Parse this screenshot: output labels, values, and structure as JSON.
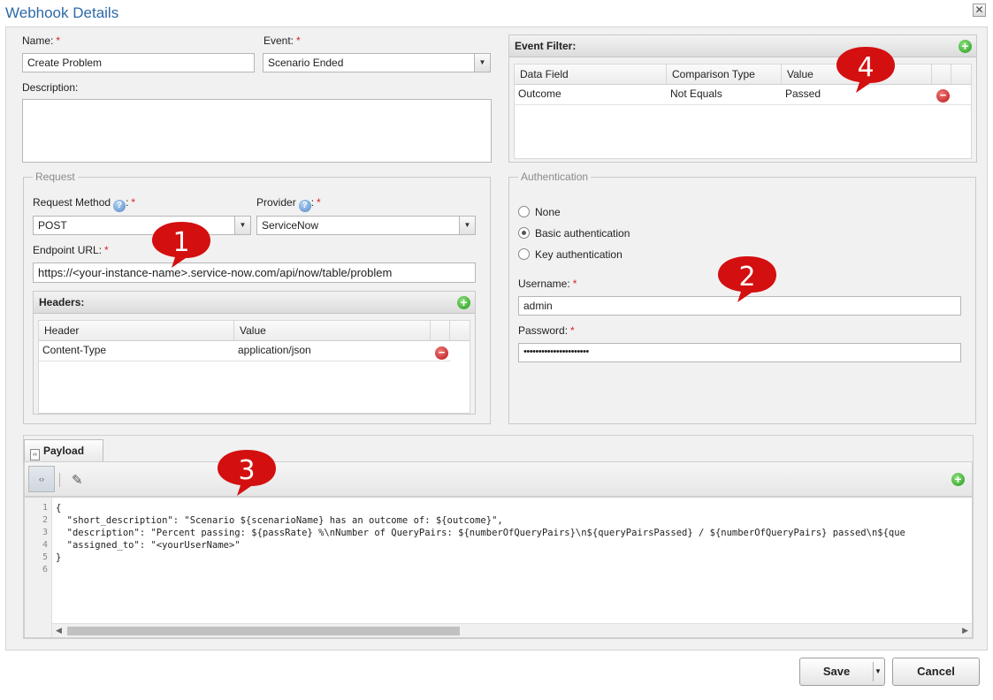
{
  "window": {
    "title": "Webhook Details"
  },
  "form": {
    "name_label": "Name:",
    "name_value": "Create Problem",
    "event_label": "Event:",
    "event_value": "Scenario Ended",
    "description_label": "Description:",
    "required_mark": "*"
  },
  "request": {
    "legend": "Request",
    "method_label": "Request Method",
    "method_value": "POST",
    "provider_label": "Provider",
    "provider_value": "ServiceNow",
    "endpoint_label": "Endpoint URL:",
    "endpoint_value": "https://<your-instance-name>.service-now.com/api/now/table/problem",
    "colon": ":",
    "help_glyph": "?",
    "headers": {
      "title": "Headers:",
      "columns": [
        "Header",
        "Value"
      ],
      "rows": [
        {
          "header": "Content-Type",
          "value": "application/json"
        }
      ]
    }
  },
  "event_filter": {
    "title": "Event Filter:",
    "columns": [
      "Data Field",
      "Comparison Type",
      "Value"
    ],
    "rows": [
      {
        "field": "Outcome",
        "comparison": "Not Equals",
        "value": "Passed"
      }
    ]
  },
  "authentication": {
    "legend": "Authentication",
    "options": [
      "None",
      "Basic authentication",
      "Key authentication"
    ],
    "selected_index": 1,
    "username_label": "Username:",
    "username_value": "admin",
    "password_label": "Password:",
    "password_value": "••••••••••••••••••••••"
  },
  "payload": {
    "tab_label": "Payload",
    "line_numbers": [
      "1",
      "2",
      "3",
      "4",
      "5",
      "6"
    ],
    "lines": [
      "{",
      "  \"short_description\": \"Scenario ${scenarioName} has an outcome of: ${outcome}\",",
      "  \"description\": \"Percent passing: ${passRate} %\\nNumber of QueryPairs: ${numberOfQueryPairs}\\n${queryPairsPassed} / ${numberOfQueryPairs} passed\\n${que",
      "  \"assigned_to\": \"<yourUserName>\"",
      "}",
      ""
    ]
  },
  "buttons": {
    "save": "Save",
    "cancel": "Cancel"
  },
  "callouts": [
    "1",
    "2",
    "3",
    "4"
  ],
  "colors": {
    "title": "#2d6aa6",
    "callout": "#d40f0f",
    "required": "#dd2222"
  }
}
